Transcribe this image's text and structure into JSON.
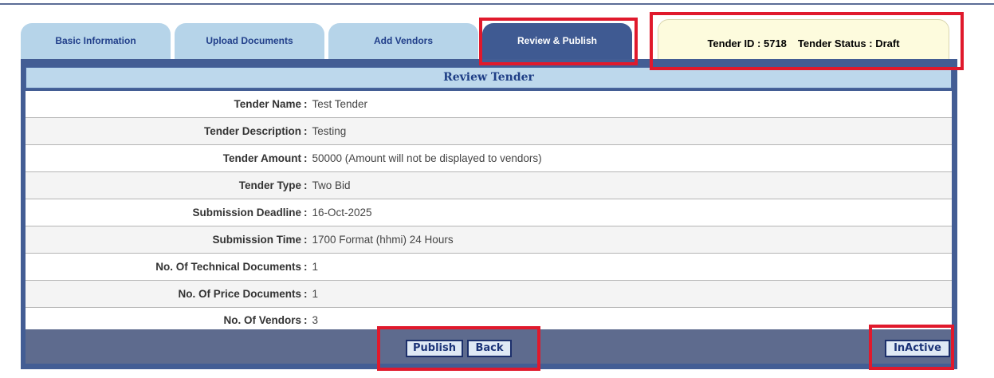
{
  "tabs": [
    {
      "label": "Basic Information",
      "active": false
    },
    {
      "label": "Upload Documents",
      "active": false
    },
    {
      "label": "Add Vendors",
      "active": false
    },
    {
      "label": "Review & Publish",
      "active": true
    }
  ],
  "status": {
    "tender_id_label": "Tender ID : 5718",
    "tender_status_label": "Tender Status : Draft"
  },
  "review": {
    "title": "Review Tender",
    "rows": [
      {
        "label": "Tender Name",
        "value": "Test Tender"
      },
      {
        "label": "Tender Description",
        "value": "Testing"
      },
      {
        "label": "Tender Amount",
        "value": "50000 (Amount will not be displayed to vendors)"
      },
      {
        "label": "Tender Type",
        "value": "Two Bid"
      },
      {
        "label": "Submission Deadline",
        "value": "16-Oct-2025"
      },
      {
        "label": "Submission Time",
        "value": "1700 Format (hhmi) 24 Hours"
      },
      {
        "label": "No. Of Technical Documents",
        "value": "1"
      },
      {
        "label": "No. Of Price Documents",
        "value": "1"
      },
      {
        "label": "No. Of Vendors",
        "value": "3"
      }
    ]
  },
  "actions": {
    "publish": "Publish",
    "back": "Back",
    "inactive": "InActive"
  },
  "colors": {
    "highlight": "#e0192c",
    "tab_active": "#3f5a92",
    "tab_inactive": "#b6d4e9",
    "status_bg": "#fdfbdd",
    "panel": "#435d94"
  }
}
